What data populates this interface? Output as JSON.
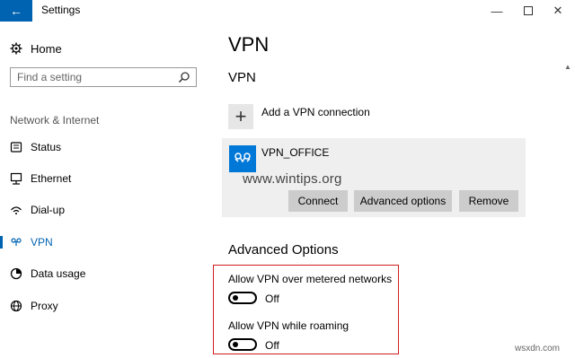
{
  "window": {
    "title": "Settings",
    "controls": [
      "minimize-icon",
      "maximize-icon",
      "close-icon"
    ]
  },
  "sidebar": {
    "home": "Home",
    "search_placeholder": "Find a setting",
    "section": "Network & Internet",
    "items": [
      {
        "label": "Status",
        "icon": "status-icon"
      },
      {
        "label": "Ethernet",
        "icon": "ethernet-icon"
      },
      {
        "label": "Dial-up",
        "icon": "dialup-icon"
      },
      {
        "label": "VPN",
        "icon": "vpn-icon",
        "active": true
      },
      {
        "label": "Data usage",
        "icon": "data-usage-icon"
      },
      {
        "label": "Proxy",
        "icon": "proxy-icon"
      }
    ]
  },
  "main": {
    "title": "VPN",
    "subtitle": "VPN",
    "add_label": "Add a VPN connection",
    "connection": {
      "name": "VPN_OFFICE",
      "buttons": [
        "Connect",
        "Advanced options",
        "Remove"
      ]
    },
    "advanced_title": "Advanced Options",
    "options": [
      {
        "label": "Allow VPN over metered networks",
        "state": "Off"
      },
      {
        "label": "Allow VPN while roaming",
        "state": "Off"
      }
    ]
  },
  "watermark": "www.wintips.org",
  "site_mark": "wsxdn.com",
  "colors": {
    "accent": "#0063b1",
    "vpn_tile": "#0078d7",
    "highlight_border": "#d01f1f"
  }
}
